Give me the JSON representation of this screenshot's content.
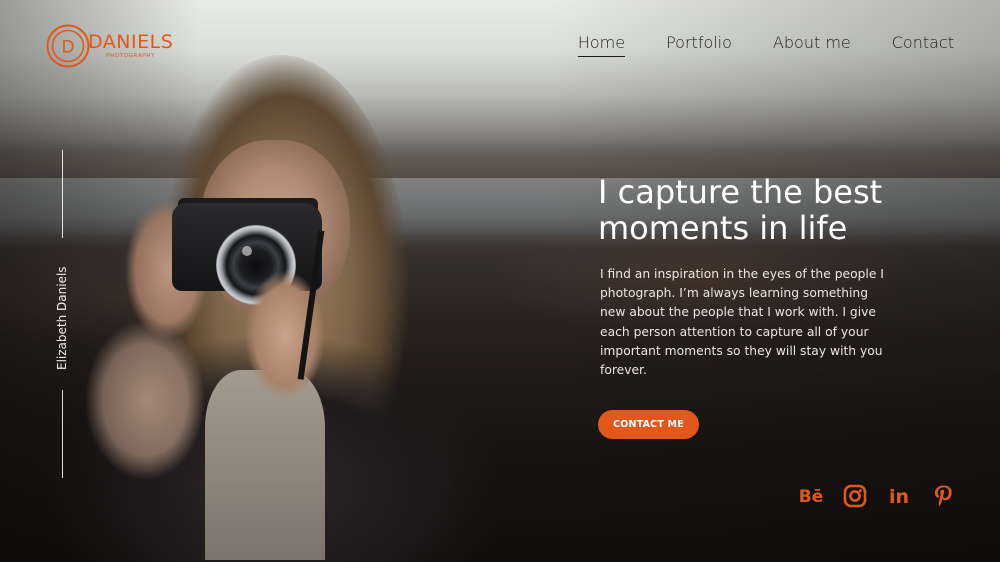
{
  "brand": {
    "logo_letter": "D",
    "name": "DANIELS",
    "sub": "PHOTOGRAPHY",
    "accent_color": "#e2571a"
  },
  "nav": {
    "items": [
      {
        "label": "Home",
        "active": true
      },
      {
        "label": "Portfolio",
        "active": false
      },
      {
        "label": "About me",
        "active": false
      },
      {
        "label": "Contact",
        "active": false
      }
    ]
  },
  "side_label": "Elizabeth Daniels",
  "hero": {
    "headline_line1": "I capture the best",
    "headline_line2": "moments in life",
    "intro": "I find an inspiration in the eyes of the people I photograph. I’m always learning something new about the people that I work with. I give each person attention to capture all of your important moments so they will stay with you forever.",
    "cta_label": "CONTACT ME"
  },
  "socials": [
    {
      "name": "behance-icon",
      "label": "Bē"
    },
    {
      "name": "instagram-icon"
    },
    {
      "name": "linkedin-icon",
      "label": "in"
    },
    {
      "name": "pinterest-icon"
    }
  ]
}
